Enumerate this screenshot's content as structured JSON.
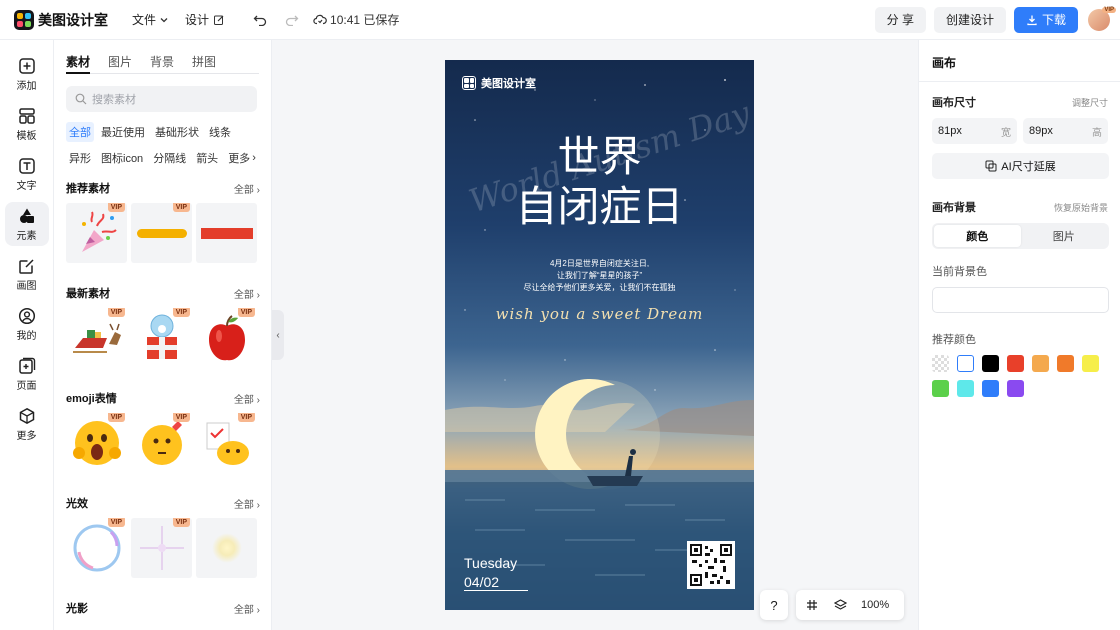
{
  "app": {
    "name": "美图设计室"
  },
  "topbar": {
    "menu_file": "文件",
    "menu_design": "设计",
    "saved_status": "10:41 已保存",
    "share_label": "分 享",
    "create_label": "创建设计",
    "download_label": "下载",
    "avatar_badge": "VIP"
  },
  "rail": {
    "items": [
      {
        "label": "添加",
        "icon": "plus-square-icon"
      },
      {
        "label": "模板",
        "icon": "template-icon"
      },
      {
        "label": "文字",
        "icon": "text-icon"
      },
      {
        "label": "元素",
        "icon": "shapes-icon"
      },
      {
        "label": "画图",
        "icon": "draw-icon"
      },
      {
        "label": "我的",
        "icon": "user-icon"
      },
      {
        "label": "页面",
        "icon": "page-add-icon"
      },
      {
        "label": "更多",
        "icon": "cube-icon"
      }
    ],
    "active_index": 3
  },
  "panel": {
    "tabs": [
      "素材",
      "图片",
      "背景",
      "拼图"
    ],
    "search_placeholder": "搜索素材",
    "chips": [
      "全部",
      "最近使用",
      "基础形状",
      "线条",
      "异形",
      "图标icon",
      "分隔线",
      "箭头",
      "更多"
    ],
    "see_all": "全部",
    "vip": "VIP",
    "sections": [
      {
        "title": "推荐素材"
      },
      {
        "title": "最新素材"
      },
      {
        "title": "emoji表情"
      },
      {
        "title": "光效"
      },
      {
        "title": "光影"
      }
    ]
  },
  "poster": {
    "brand": "美图设计室",
    "title_line1": "世界",
    "title_line2": "自闭症日",
    "script_bg": "World Autism Day",
    "body_line1": "4月2日是世界自闭症关注日,",
    "body_line2": "让我们了解“星星的孩子”",
    "body_line3": "尽让全给予他们更多关爱，让我们不在孤独",
    "wish": "wish you a sweet Dream",
    "day": "Tuesday",
    "date": "04/02"
  },
  "bottom": {
    "zoom": "100%",
    "help": "?"
  },
  "rpanel": {
    "title": "画布",
    "size_label": "画布尺寸",
    "adjust_size": "调整尺寸",
    "width_value": "81px",
    "width_unit": "宽",
    "height_value": "89px",
    "height_unit": "高",
    "ai_extend": "AI尺寸延展",
    "bg_label": "画布背景",
    "restore_bg": "恢复原始背景",
    "seg_color": "颜色",
    "seg_image": "图片",
    "current_bg": "当前背景色",
    "recommend": "推荐颜色",
    "swatches": [
      "transparent",
      "#ffffff",
      "#000000",
      "#e8402a",
      "#f4a94e",
      "#f07a2a",
      "#f6ee4a",
      "#5bd04a",
      "#5ee8ea",
      "#2f7dfa",
      "#8a4af0"
    ]
  }
}
